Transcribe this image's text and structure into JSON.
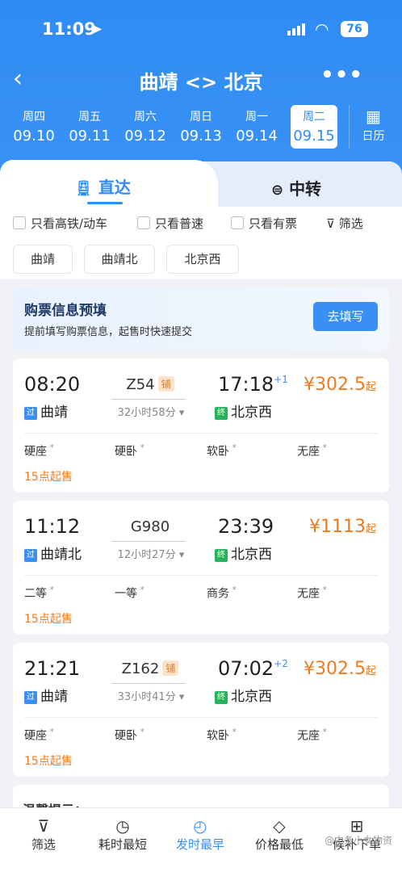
{
  "status": {
    "time": "11:09",
    "battery": "76"
  },
  "nav": {
    "back_icon": "chevron-left-icon",
    "title": "曲靖 <> 北京",
    "more_icon": "more-icon"
  },
  "dates": [
    {
      "weekday": "周四",
      "date": "09.10"
    },
    {
      "weekday": "周五",
      "date": "09.11"
    },
    {
      "weekday": "周六",
      "date": "09.12"
    },
    {
      "weekday": "周日",
      "date": "09.13"
    },
    {
      "weekday": "周一",
      "date": "09.14"
    },
    {
      "weekday": "周二",
      "date": "09.15",
      "selected": true
    }
  ],
  "calendar_label": "日历",
  "tabs": {
    "direct": "直达",
    "transfer": "中转"
  },
  "filters": {
    "gaotie": "只看高铁/动车",
    "puSu": "只看普速",
    "youPiao": "只看有票",
    "filter": "筛选"
  },
  "stations": [
    "曲靖",
    "曲靖北",
    "北京西"
  ],
  "notice": {
    "title": "购票信息预填",
    "subtitle": "提前填写购票信息，起售时快速提交",
    "button": "去填写"
  },
  "trains": [
    {
      "dep": "08:20",
      "train_no": "Z54",
      "badge": "铺",
      "arr": "17:18",
      "plus": "+1",
      "price": "¥302.5",
      "price_suffix": "起",
      "duration": "32小时58分",
      "from_tag": "过",
      "from": "曲靖",
      "to_tag": "终",
      "to": "北京西",
      "seats": [
        "硬座",
        "硬卧",
        "软卧",
        "无座"
      ],
      "sale": "15点起售"
    },
    {
      "dep": "11:12",
      "train_no": "G980",
      "badge": "",
      "arr": "23:39",
      "plus": "",
      "price": "¥1113",
      "price_suffix": "起",
      "duration": "12小时27分",
      "from_tag": "过",
      "from": "曲靖北",
      "to_tag": "终",
      "to": "北京西",
      "seats": [
        "二等",
        "一等",
        "商务",
        "无座"
      ],
      "sale": "15点起售"
    },
    {
      "dep": "21:21",
      "train_no": "Z162",
      "badge": "铺",
      "arr": "07:02",
      "plus": "+2",
      "price": "¥302.5",
      "price_suffix": "起",
      "duration": "33小时41分",
      "from_tag": "过",
      "from": "曲靖",
      "to_tag": "终",
      "to": "北京西",
      "seats": [
        "硬座",
        "硬卧",
        "软卧",
        "无座"
      ],
      "sale": "15点起售"
    }
  ],
  "tip_title": "温馨提示：",
  "bottom": [
    {
      "label": "筛选",
      "icon": "filter-icon"
    },
    {
      "label": "耗时最短",
      "icon": "timer-icon"
    },
    {
      "label": "发时最早",
      "icon": "clock-24-icon",
      "active": true
    },
    {
      "label": "价格最低",
      "icon": "price-tag-icon"
    },
    {
      "label": "候补下单",
      "icon": "cart-icon"
    }
  ],
  "watermark": "@中条小女物资"
}
